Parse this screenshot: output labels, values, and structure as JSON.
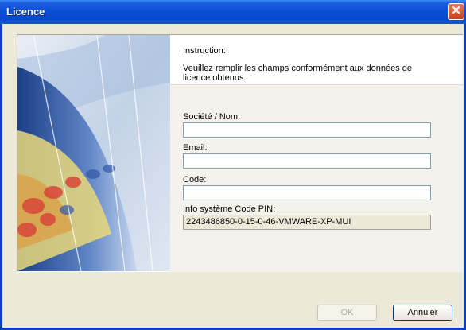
{
  "window": {
    "title": "Licence",
    "close_glyph": "✕"
  },
  "instruction": {
    "heading": "Instruction:",
    "body_line1": "Veuillez remplir les champs conformément aux données de",
    "body_line2": "licence obtenus."
  },
  "form": {
    "societe_label": "Société / Nom:",
    "societe_value": "",
    "email_label": "Email:",
    "email_value": "",
    "code_label": "Code:",
    "code_value": "",
    "pin_label": "Info système Code PIN:",
    "pin_value": "2243486850-0-15-0-46-VMWARE-XP-MUI"
  },
  "buttons": {
    "ok_accel": "O",
    "ok_rest": "K",
    "cancel_accel": "A",
    "cancel_rest": "nnuler"
  },
  "colors": {
    "titlebar": "#0a4fd6",
    "dialog_bg": "#ece9d8",
    "content_bg": "#ffffff"
  }
}
